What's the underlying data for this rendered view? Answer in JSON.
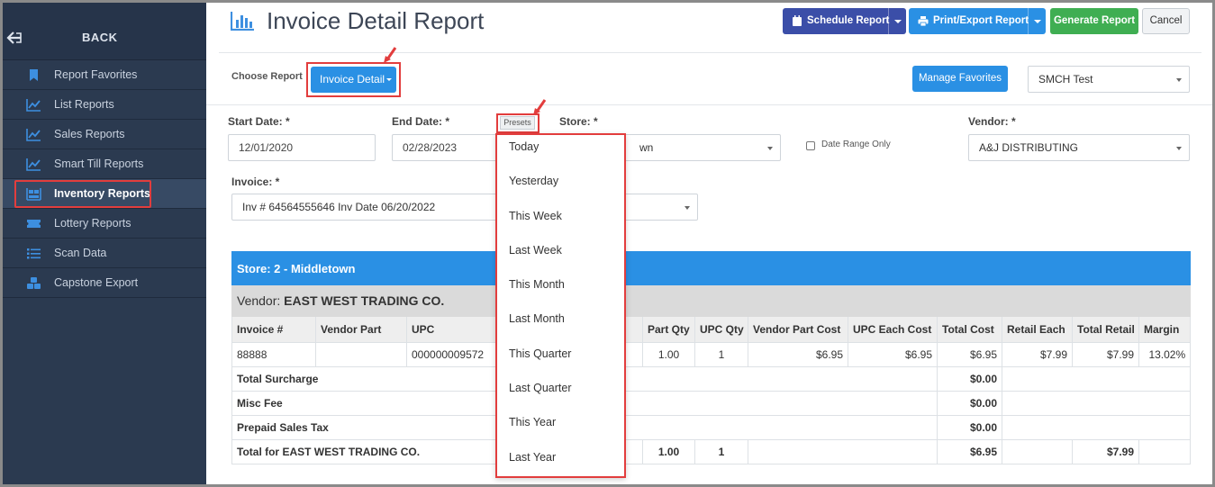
{
  "sidebar": {
    "back_label": "BACK",
    "items": [
      {
        "label": "Report Favorites",
        "icon": "bookmark-icon"
      },
      {
        "label": "List Reports",
        "icon": "line-chart-icon"
      },
      {
        "label": "Sales Reports",
        "icon": "line-chart-icon"
      },
      {
        "label": "Smart Till Reports",
        "icon": "line-chart-icon"
      },
      {
        "label": "Inventory Reports",
        "icon": "inventory-icon",
        "active": true
      },
      {
        "label": "Lottery Reports",
        "icon": "ticket-icon"
      },
      {
        "label": "Scan Data",
        "icon": "list-icon"
      },
      {
        "label": "Capstone Export",
        "icon": "boxes-icon"
      }
    ]
  },
  "header": {
    "title": "Invoice Detail Report",
    "schedule_label": "Schedule Report",
    "print_label": "Print/Export Report",
    "generate_label": "Generate Report",
    "cancel_label": "Cancel"
  },
  "report_chooser": {
    "label": "Choose Report",
    "selected": "Invoice Detail",
    "manage_favorites_label": "Manage Favorites",
    "favorite_selected": "SMCH Test"
  },
  "filters": {
    "start_date_label": "Start Date: *",
    "start_date": "12/01/2020",
    "end_date_label": "End Date: *",
    "end_date": "02/28/2023",
    "presets_label": "Presets",
    "store_label": "Store: *",
    "store_value_visible": "wn",
    "date_range_only_label": "Date Range Only",
    "vendor_label": "Vendor: *",
    "vendor_value": "A&J DISTRIBUTING",
    "invoice_label": "Invoice: *",
    "invoice_value": "Inv # 64564555646 Inv Date 06/20/2022"
  },
  "presets_menu": [
    "Today",
    "Yesterday",
    "This Week",
    "Last Week",
    "This Month",
    "Last Month",
    "This Quarter",
    "Last Quarter",
    "This Year",
    "Last Year"
  ],
  "table": {
    "store_header": "Store: 2 - Middletown",
    "vendor_prefix": "Vendor: ",
    "vendor_name": "EAST WEST TRADING CO.",
    "columns": [
      "Invoice #",
      "Vendor Part",
      "UPC",
      "",
      "Part Qty",
      "UPC Qty",
      "Vendor Part Cost",
      "UPC Each Cost",
      "Total Cost",
      "Retail Each",
      "Total Retail",
      "Margin"
    ],
    "row": {
      "invoice": "88888",
      "vendor_part": "",
      "upc": "000000009572",
      "desc": "",
      "part_qty": "1.00",
      "upc_qty": "1",
      "vendor_part_cost": "$6.95",
      "upc_each_cost": "$6.95",
      "total_cost": "$6.95",
      "retail_each": "$7.99",
      "total_retail": "$7.99",
      "margin": "13.02%"
    },
    "total_surcharge_label": "Total Surcharge",
    "total_surcharge": "$0.00",
    "misc_fee_label": "Misc Fee",
    "misc_fee": "$0.00",
    "prepaid_tax_label": "Prepaid Sales Tax",
    "prepaid_tax": "$0.00",
    "total_label": "Total for EAST WEST TRADING CO.",
    "total_part_qty": "1.00",
    "total_upc_qty": "1",
    "total_cost": "$6.95",
    "total_retail": "$7.99"
  },
  "colors": {
    "sidebar_bg": "#2b3a50",
    "accent_blue": "#2a90e4",
    "schedule_blue": "#3b4ea8",
    "generate_green": "#3fae52",
    "highlight_red": "#e23d3d"
  }
}
